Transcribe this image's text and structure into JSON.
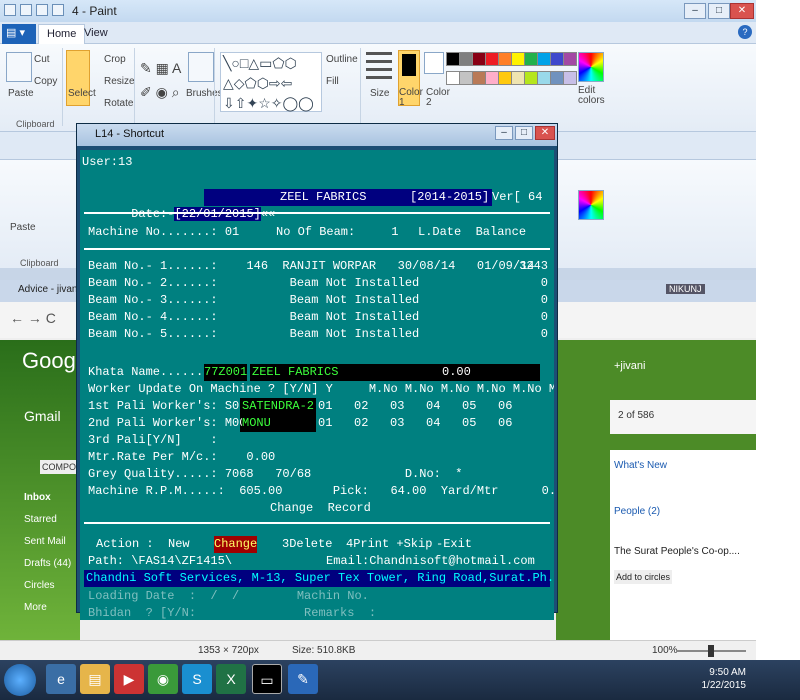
{
  "paint": {
    "title": "4 - Paint",
    "tabs": [
      "Home",
      "View"
    ],
    "clipboard": {
      "paste": "Paste",
      "cut": "Cut",
      "copy": "Copy",
      "label": "Clipboard"
    },
    "image": {
      "select": "Select",
      "crop": "Crop",
      "resize": "Resize",
      "rotate": "Rotate"
    },
    "brushes": "Brushes",
    "outline": "Outline",
    "fill": "Fill",
    "size": "Size",
    "color1": "Color\n1",
    "color2": "Color\n2",
    "edit_colors": "Edit\ncolors",
    "palette": [
      "#000000",
      "#7f7f7f",
      "#880015",
      "#ed1c24",
      "#ff7f27",
      "#fff200",
      "#22b14c",
      "#00a2e8",
      "#3f48cc",
      "#a349a4",
      "#ffffff",
      "#c3c3c3",
      "#b97a57",
      "#ffaec9",
      "#ffc90e",
      "#efe4b0",
      "#b5e61d",
      "#99d9ea",
      "#7092be",
      "#c8bfe7"
    ]
  },
  "console": {
    "title": "L14 - Shortcut",
    "user": "User:13",
    "date_prefix": "Date:-",
    "date": "[22/01/2015]",
    "arrows": "««",
    "company": "ZEEL FABRICS",
    "year": "[2014-2015]",
    "ver": "Ver[ 64  ]",
    "machine_no": "Machine No.......: 01",
    "no_of_beam": "No Of Beam:     1",
    "ldate_balance": "L.Date  Balance",
    "beams": [
      {
        "label": "Beam No.- 1......:",
        "info": "    146  RANJIT WORPAR   30/08/14   01/09/14   43",
        "bal": "3243"
      },
      {
        "label": "Beam No.- 2......:",
        "info": "          Beam Not Installed                    0",
        "bal": "0"
      },
      {
        "label": "Beam No.- 3......:",
        "info": "          Beam Not Installed                    0",
        "bal": "0"
      },
      {
        "label": "Beam No.- 4......:",
        "info": "          Beam Not Installed                    0",
        "bal": "0"
      },
      {
        "label": "Beam No.- 5......:",
        "info": "          Beam Not Installed                    0",
        "bal": "0"
      }
    ],
    "khata_label": "Khata Name.......:",
    "khata_code": "77Z001",
    "khata_name": "ZEEL FABRICS",
    "khata_amount": "0.00",
    "worker_update": "Worker Update On Machine ? [Y/N] Y     M.No M.No M.No M.No M.No M.No M.No M.No",
    "pali1_label": "1st Pali Worker's: S012",
    "pali1_name": "SATENDRA-2",
    "pali1_nums": "01   02   03   04   05   06",
    "pali2_label": "2nd Pali Worker's: M001",
    "pali2_name": "MONU",
    "pali2_nums": "01   02   03   04   05   06",
    "pali3": "3rd Pali[Y/N]    :",
    "mtr_rate": "Mtr.Rate Per M/c.:    0.00",
    "grey_quality": "Grey Quality.....: 7068   70/68             D.No:  *",
    "rpm": "Machine R.P.M.....:  605.00       Pick:   64.00  Yard/Mtr      0.00",
    "change_record": "Change  Record",
    "action_label": "Action :",
    "action_new": "New",
    "action_change": "Change",
    "action_delete": "3Delete",
    "action_print": "4Print +Skip",
    "action_exit": "-Exit",
    "path": "Path: \\FAS14\\ZF1415\\",
    "email": "Email:Chandnisoft@hotmail.com",
    "footer": "Chandni Soft Services, M-13, Super Tex Tower, Ring Road,Surat.Ph.0261-2354416",
    "behind_lines": "Loading Date  :  /  /        Machin No.",
    "behind_lines2": "Bhidan  ? [Y/N:               Remarks  :"
  },
  "background": {
    "chrome_tab": "Advice - jivani",
    "gmail": "Gmail",
    "compose": "COMPOSE",
    "inbox": "Inbox",
    "starred": "Starred",
    "sent": "Sent Mail",
    "drafts": "Drafts (44)",
    "circles": "Circles",
    "more": "More",
    "user": "+jivani",
    "pager": "2 of 586",
    "whats_new": "What's New",
    "people": "People (2)",
    "surat": "The Surat People's Co-op....",
    "add_circles": "Add to circles",
    "nikunj": "NIKUNJ"
  },
  "status": {
    "dims": "1353 × 720px",
    "size": "Size: 510.8KB",
    "zoom": "100%"
  },
  "taskbar": {
    "time": "9:50 AM",
    "date": "1/22/2015"
  }
}
